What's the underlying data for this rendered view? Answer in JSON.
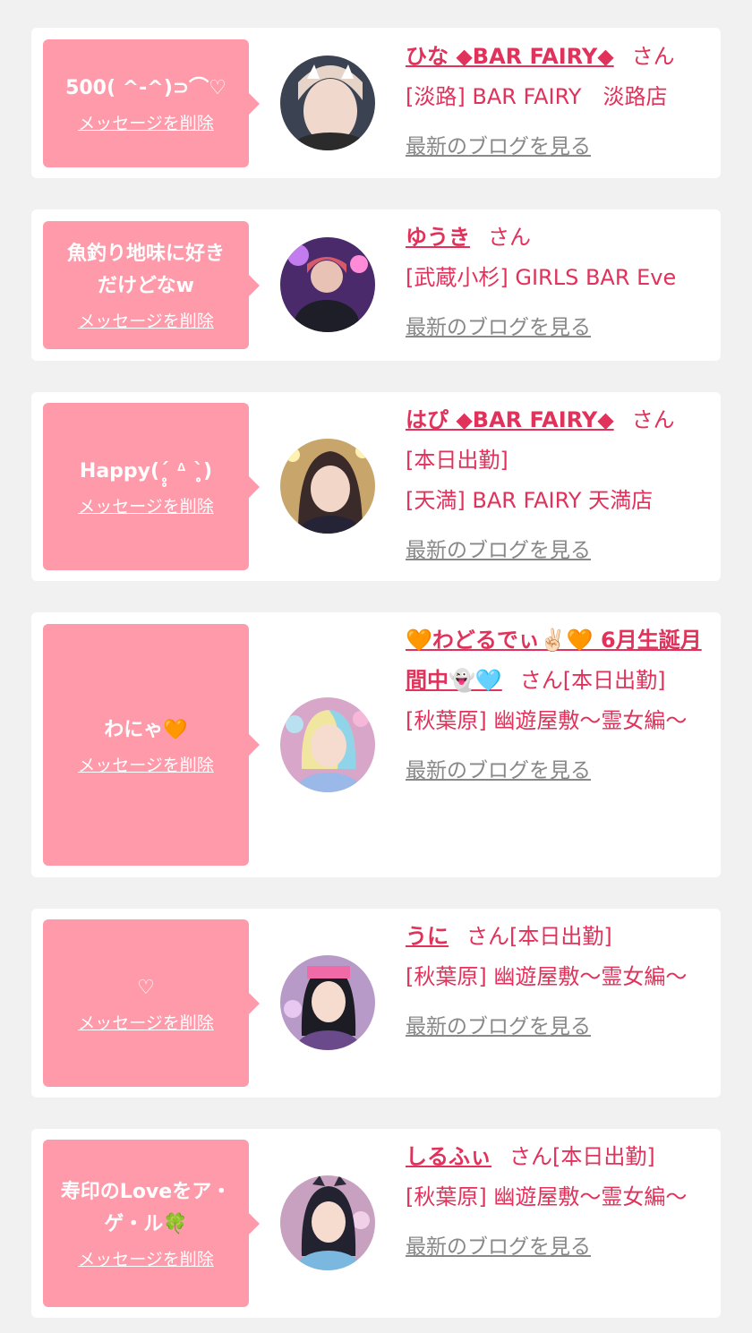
{
  "delete_label": "メッセージを削除",
  "blog_label": "最新のブログを見る",
  "san_label": "さん",
  "colors": {
    "bubble": "#fe9aa9",
    "accent": "#e0325a",
    "link_gray": "#888888",
    "background": "#f1f1f1"
  },
  "cards": [
    {
      "message": "500( ^-^)⊃⌒♡",
      "name": "ひな ◆BAR FAIRY◆",
      "status": "",
      "store": "[淡路] BAR FAIRY　淡路店"
    },
    {
      "message": "魚釣り地味に好き\nだけどなw",
      "name": "ゆうき",
      "status": "",
      "store": "[武蔵小杉] GIRLS BAR Eve"
    },
    {
      "message": "Happy(ˊ̥̥ ᐞ ˋ̥̥)",
      "name": "はぴ ◆BAR FAIRY◆",
      "status": "[本日出勤]",
      "store": "[天満] BAR FAIRY 天満店"
    },
    {
      "message": "わにゃ🧡",
      "name": "🧡わどるでぃ✌🏻🧡 6月生誕月間中👻🩵",
      "status": "[本日出勤]",
      "store": "[秋葉原] 幽遊屋敷～霊女編～"
    },
    {
      "message": "♡",
      "name": "うに",
      "status": "[本日出勤]",
      "store": "[秋葉原] 幽遊屋敷～霊女編～"
    },
    {
      "message": "寿印のLoveをア・\nゲ・ル🍀",
      "name": "しるふぃ",
      "status": "[本日出勤]",
      "store": "[秋葉原] 幽遊屋敷～霊女編～"
    }
  ]
}
